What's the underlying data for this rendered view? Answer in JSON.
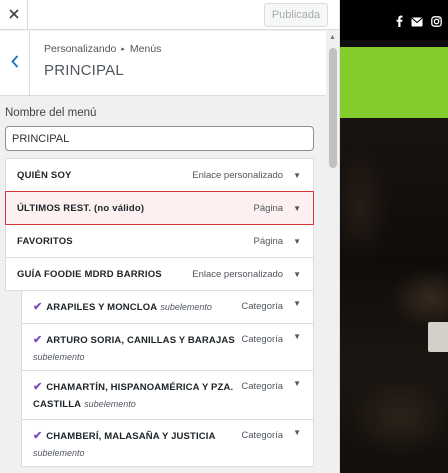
{
  "topbar": {
    "close_icon": "close-icon",
    "publish_label": "Publicada"
  },
  "header": {
    "breadcrumb_parent": "Personalizando",
    "breadcrumb_current": "Menús",
    "title": "PRINCIPAL",
    "back_icon": "chevron-left-icon"
  },
  "menu_name": {
    "label": "Nombre del menú",
    "value": "PRINCIPAL"
  },
  "items": [
    {
      "title": "QUIÉN SOY",
      "type": "Enlace personalizado",
      "invalid": false
    },
    {
      "title": "ÚLTIMOS REST. (no válido)",
      "type": "Página",
      "invalid": true
    },
    {
      "title": "FAVORITOS",
      "type": "Página",
      "invalid": false
    },
    {
      "title": "GUÍA FOODIE MDRD BARRIOS",
      "type": "Enlace personalizado",
      "invalid": false
    }
  ],
  "subitems": [
    {
      "title": "ARAPILES Y MONCLOA",
      "subelement": "subelemento",
      "type": "Categoría"
    },
    {
      "title": "ARTURO SORIA, CANILLAS Y BARAJAS",
      "subelement": "subelemento",
      "type": "Categoría"
    },
    {
      "title": "CHAMARTÍN, HISPANOAMÉRICA Y PZA. CASTILLA",
      "subelement": "subelemento",
      "type": "Categoría"
    },
    {
      "title": "CHAMBERÍ, MALASAÑA Y JUSTICIA",
      "subelement": "subelemento",
      "type": "Categoría"
    }
  ],
  "preview": {
    "social_icons": [
      "facebook-icon",
      "mail-icon",
      "instagram-icon"
    ],
    "brand_green": "#84cc2b"
  },
  "colors": {
    "invalid_border": "#d63638",
    "check": "#7c4cc4",
    "link": "#2271b1"
  }
}
